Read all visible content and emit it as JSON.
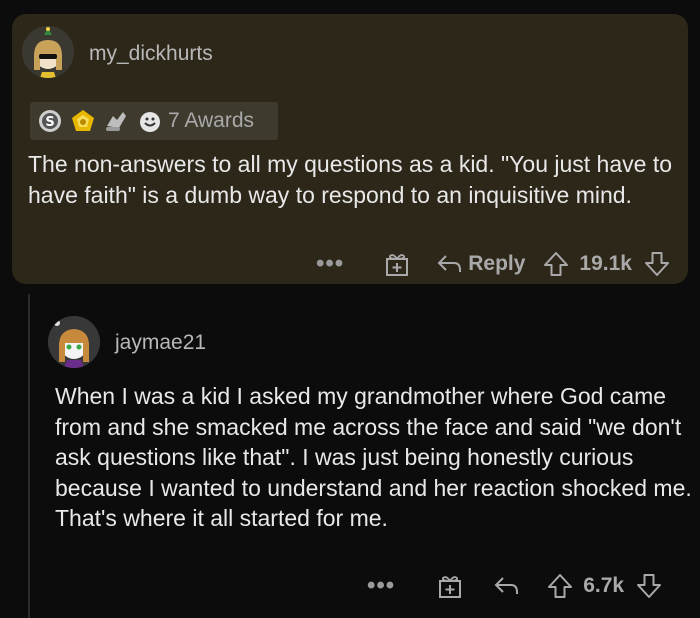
{
  "colors": {
    "background": "#0c0c0c",
    "highlight_card": "#2c2719",
    "text": "#e8e8e8",
    "muted": "#a9a9a9"
  },
  "comments": [
    {
      "username": "my_dickhurts",
      "awards_label": "7 Awards",
      "award_icons": [
        "silver-award-icon",
        "gold-award-icon",
        "helpful-award-icon",
        "wholesome-award-icon"
      ],
      "text": "The non-answers to all my questions as a kid. \"You just have to have faith\" is a dumb way to respond to an inquisitive mind.",
      "more_label": "•••",
      "reply_label": "Reply",
      "score": "19.1k"
    },
    {
      "username": "jaymae21",
      "text": "When I was a kid I asked my grandmother where God came from and she smacked me across the face and said \"we don't ask questions like that\". I was just being honestly curious because I wanted to understand and her reaction shocked me. That's where it all started for me.",
      "more_label": "•••",
      "score": "6.7k"
    }
  ]
}
